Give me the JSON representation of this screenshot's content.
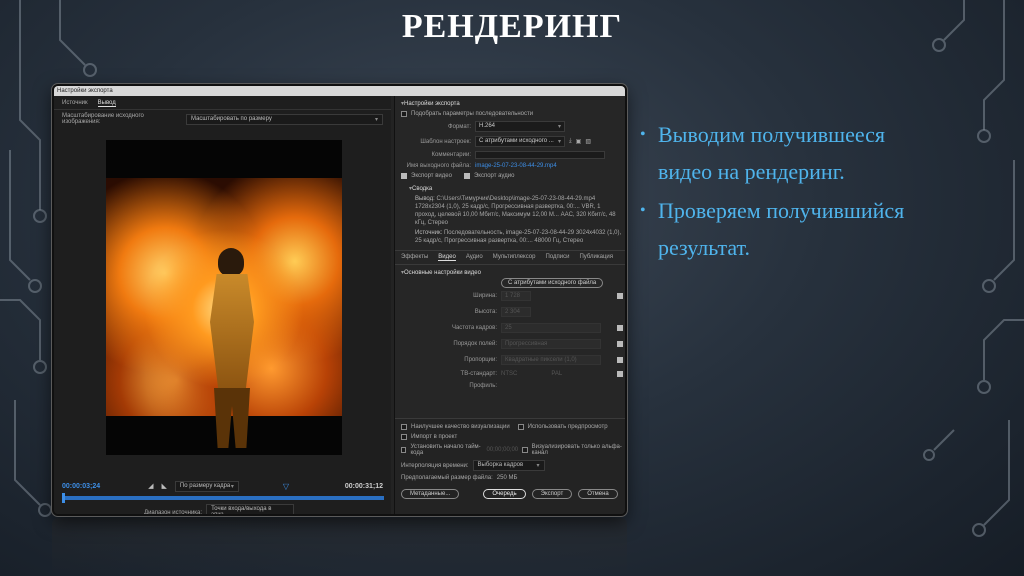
{
  "slide": {
    "title": "РЕНДЕРИНГ",
    "bullets": [
      "Выводим получившееся видео на рендеринг.",
      "Проверяем получившийся результат."
    ]
  },
  "dialog": {
    "title": "Настройки экспорта",
    "left": {
      "tabs": [
        "Источник",
        "Вывод"
      ],
      "active_tab": "Вывод",
      "scaling_label": "Масштабирование исходного изображения:",
      "scaling_value": "Масштабировать по размеру",
      "timecode_start": "00:00:03;24",
      "timecode_end": "00:00:31;12",
      "fit_value": "По размеру кадра",
      "source_range_label": "Диапазон источника:",
      "source_range_value": "Точки входа/выхода в эпиз..."
    },
    "right": {
      "section_title": "Настройки экспорта",
      "match_sequence_label": "Подобрать параметры последовательности",
      "format_label": "Формат:",
      "format_value": "H.264",
      "preset_label": "Шаблон настроек:",
      "preset_value": "С атрибутами исходного ...",
      "comments_label": "Комментарии:",
      "output_label": "Имя выходного файла:",
      "output_value": "image-25-07-23-08-44-29.mp4",
      "export_video": "Экспорт видео",
      "export_audio": "Экспорт аудио",
      "summary_title": "Сводка",
      "summary_output_key": "Вывод:",
      "summary_output": "C:\\Users\\Tимуpчик\\Desktop\\image-25-07-23-08-44-29.mp4 1728x2304 (1,0), 25 кадр/с, Прогрессивная развертка, 00:... VBR, 1 проход, целевой 10,00 Мбит/с, Максимум 12,00 М... AAC, 320 Кбит/с, 48 кГц, Стерео",
      "summary_source_key": "Источник:",
      "summary_source": "Последовательность, image-25-07-23-08-44-29 3024x4032 (1,0), 25 кадр/с, Прогрессивная развертка, 00:... 48000 Гц, Стерео",
      "tabs": [
        "Эффекты",
        "Видео",
        "Аудио",
        "Мультиплексор",
        "Подписи",
        "Публикация"
      ],
      "active_tab": "Видео",
      "basic_video_title": "Основные настройки видео",
      "match_source_button": "С атрибутами исходного файла",
      "width_label": "Ширина:",
      "width_value": "1 728",
      "height_label": "Высота:",
      "height_value": "2 304",
      "frame_rate_label": "Частота кадров:",
      "frame_rate_value": "25",
      "field_order_label": "Порядок полей:",
      "field_order_value": "Прогрессивная",
      "aspect_label": "Пропорции:",
      "aspect_value": "Квадратные пиксели (1,0)",
      "tv_label": "ТВ-стандарт:",
      "tv_ntsc": "NTSC",
      "tv_pal": "PAL",
      "profile_label": "Профиль:",
      "max_quality": "Наилучшее качество визуализации",
      "use_previews": "Использовать предпросмотр",
      "import_project": "Импорт в проект",
      "start_timecode": "Установить начало тайм-кода",
      "start_timecode_value": "00;00;00;00",
      "alpha_only": "Визуализировать только альфа-канал",
      "interp_label": "Интерполяция времени:",
      "interp_value": "Выборка кадров",
      "file_size_label": "Предполагаемый размер файла:",
      "file_size_value": "250 МБ",
      "buttons": {
        "metadata": "Метаданные...",
        "queue": "Очередь",
        "export": "Экспорт",
        "cancel": "Отмена"
      }
    }
  },
  "progress": {
    "playhead_fraction": 0.0
  }
}
